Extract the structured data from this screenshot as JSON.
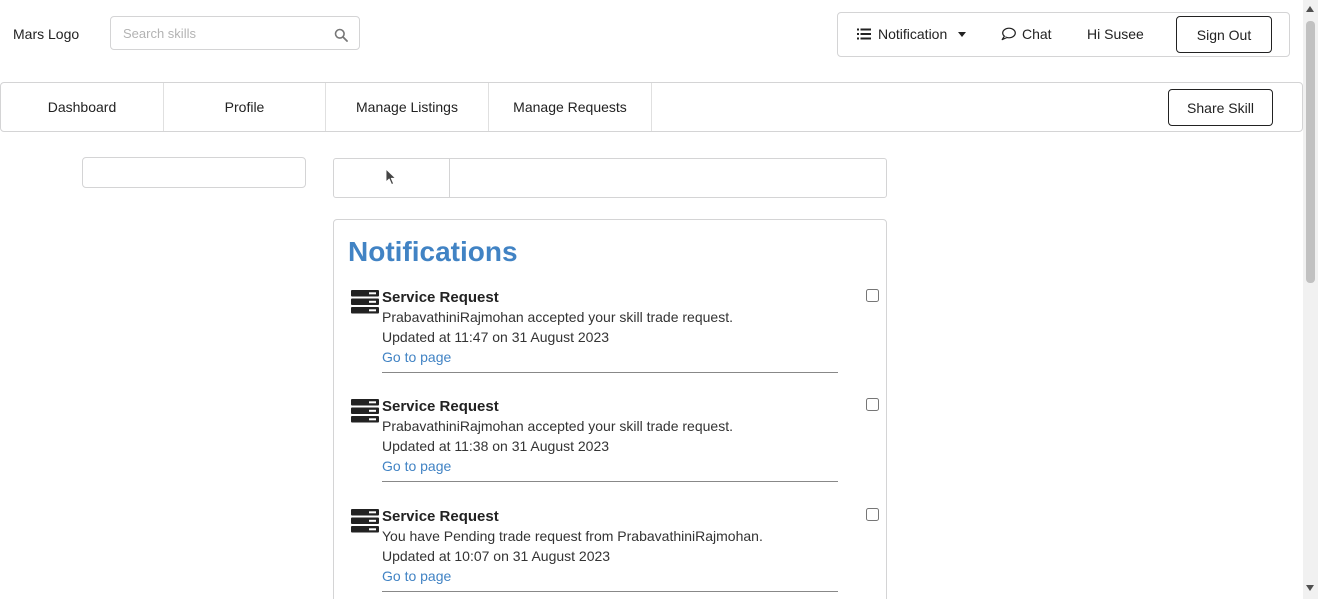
{
  "header": {
    "logo": "Mars Logo",
    "search_placeholder": "Search skills",
    "search_icon": "search-icon"
  },
  "topmenu": {
    "notification_label": "Notification",
    "chat_label": "Chat",
    "greeting": "Hi Susee",
    "signout_label": "Sign Out"
  },
  "nav": {
    "items": [
      "Dashboard",
      "Profile",
      "Manage Listings",
      "Manage Requests"
    ],
    "share_label": "Share Skill"
  },
  "notifications": {
    "title": "Notifications",
    "items": [
      {
        "title": "Service Request",
        "description": "PrabavathiniRajmohan accepted your skill trade request.",
        "updated": "Updated at 11:47 on 31 August 2023",
        "link": "Go to page"
      },
      {
        "title": "Service Request",
        "description": "PrabavathiniRajmohan accepted your skill trade request.",
        "updated": "Updated at 11:38 on 31 August 2023",
        "link": "Go to page"
      },
      {
        "title": "Service Request",
        "description": "You have Pending trade request from PrabavathiniRajmohan.",
        "updated": "Updated at 10:07 on 31 August 2023",
        "link": "Go to page"
      }
    ]
  },
  "colors": {
    "accent": "#4183c4",
    "border": "#d4d4d5",
    "text": "#212121"
  }
}
